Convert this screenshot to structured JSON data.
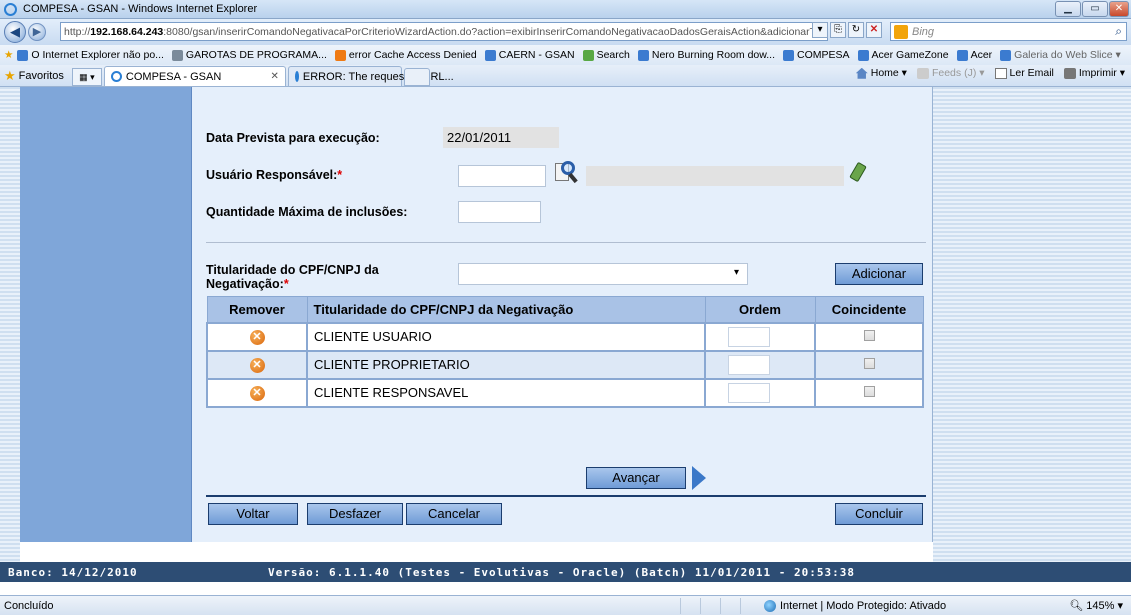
{
  "window": {
    "title": "COMPESA - GSAN - Windows Internet Explorer"
  },
  "address": {
    "url_prefix": "http://",
    "url_host": "192.168.64.243",
    "url_rest": ":8080/gsan/inserirComandoNegativacaPorCriterioWizardAction.do?action=exibirInserirComandoNegativacaoDadosGeraisAction&adicionarTit",
    "search_placeholder": "Bing"
  },
  "favorites": [
    {
      "label": "O Internet Explorer não po...",
      "icon": "ie-page-icon",
      "dim": false
    },
    {
      "label": "GAROTAS DE PROGRAMA...",
      "icon": "page-icon",
      "dim": false
    },
    {
      "label": "error Cache Access Denied",
      "icon": "bing-icon",
      "dim": false
    },
    {
      "label": "CAERN - GSAN",
      "icon": "ie-page-icon",
      "dim": false
    },
    {
      "label": "Search",
      "icon": "messenger-icon",
      "dim": false
    },
    {
      "label": "Nero Burning Room dow...",
      "icon": "ie-page-icon",
      "dim": false
    },
    {
      "label": "COMPESA",
      "icon": "ie-page-icon",
      "dim": false
    },
    {
      "label": "Acer GameZone",
      "icon": "acer-icon",
      "dim": false
    },
    {
      "label": "Acer",
      "icon": "acer-icon",
      "dim": false
    },
    {
      "label": "Galeria do Web Slice ▾",
      "icon": "ie-page-icon",
      "dim": true
    }
  ],
  "tabs": {
    "favoritos": "Favoritos",
    "items": [
      {
        "label": "COMPESA - GSAN"
      },
      {
        "label": "ERROR: The requested URL..."
      }
    ],
    "commands": {
      "home": "Home",
      "feeds": "Feeds (J)",
      "mail": "Ler Email",
      "print": "Imprimir"
    }
  },
  "form": {
    "data_prevista_label": "Data Prevista para execução:",
    "data_prevista_value": "22/01/2011",
    "usuario_label": "Usuário Responsável:",
    "usuario_req": "*",
    "quantidade_label": "Quantidade Máxima de inclusões:",
    "titularidade_label_line1": "Titularidade do CPF/CNPJ da",
    "titularidade_label_line2": "Negativação:",
    "titularidade_req": "*",
    "adicionar": "Adicionar"
  },
  "table": {
    "headers": [
      "Remover",
      "Titularidade do CPF/CNPJ da Negativação",
      "Ordem",
      "Coincidente"
    ],
    "rows": [
      {
        "name": "CLIENTE USUARIO"
      },
      {
        "name": "CLIENTE PROPRIETARIO"
      },
      {
        "name": "CLIENTE RESPONSAVEL"
      }
    ]
  },
  "buttons": {
    "avancar": "Avançar",
    "voltar": "Voltar",
    "desfazer": "Desfazer",
    "cancelar": "Cancelar",
    "concluir": "Concluir"
  },
  "footer": {
    "banco": "Banco: 14/12/2010",
    "versao": "Versão: 6.1.1.40 (Testes - Evolutivas - Oracle) (Batch) 11/01/2011 - 20:53:38"
  },
  "status": {
    "left": "Concluído",
    "zone": "Internet | Modo Protegido: Ativado",
    "zoom": "145%"
  }
}
